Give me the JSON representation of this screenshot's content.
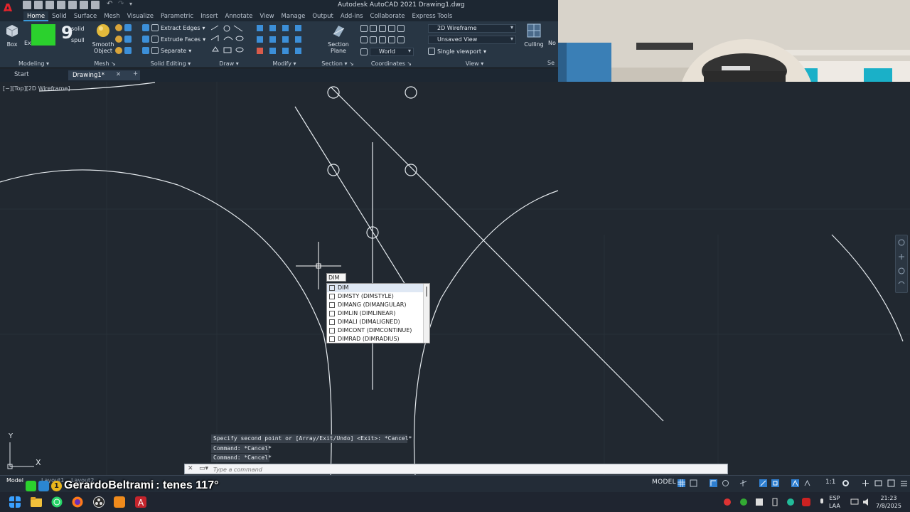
{
  "title_bar": {
    "app_logo": "A",
    "title": "Autodesk AutoCAD 2021    Drawing1.dwg"
  },
  "ribbon_tabs": [
    "Home",
    "Solid",
    "Surface",
    "Mesh",
    "Visualize",
    "Parametric",
    "Insert",
    "Annotate",
    "View",
    "Manage",
    "Output",
    "Add-ins",
    "Collaborate",
    "Express Tools"
  ],
  "active_tab": "Home",
  "ribbon": {
    "box_label": "Box",
    "extrude_label": "Extrude",
    "solid_label": "solid",
    "spull_label": "spull",
    "smooth_label_1": "Smooth",
    "smooth_label_2": "Object",
    "extract_edges": "Extract Edges",
    "extrude_faces": "Extrude Faces",
    "separate": "Separate",
    "section_plane_1": "Section",
    "section_plane_2": "Plane",
    "visual_style": "2D Wireframe",
    "named_view": "Unsaved View",
    "ucs": "World",
    "viewport": "Single viewport",
    "culling": "Culling",
    "no_label": "No",
    "panels": {
      "modeling": "Modeling",
      "mesh": "Mesh",
      "solid_editing": "Solid Editing",
      "draw": "Draw",
      "modify": "Modify",
      "section": "Section",
      "coordinates": "Coordinates",
      "view": "View",
      "se": "Se"
    }
  },
  "doc_tabs": {
    "start": "Start",
    "drawing": "Drawing1*",
    "close": "✕",
    "add": "+"
  },
  "viewport_label": "[−][Top][2D Wireframe]",
  "stream_overlay": {
    "counter": "9"
  },
  "autocomplete": {
    "typed": "DIM",
    "items": [
      "DIM",
      "DIMSTY (DIMSTYLE)",
      "DIMANG (DIMANGULAR)",
      "DIMLIN (DIMLINEAR)",
      "DIMALI (DIMALIGNED)",
      "DIMCONT (DIMCONTINUE)",
      "DIMRAD (DIMRADIUS)"
    ]
  },
  "command_history": [
    "Specify second point or [Array/Exit/Undo] <Exit>: *Cancel*",
    "Command: *Cancel*",
    "Command: *Cancel*"
  ],
  "command_line": {
    "placeholder": "Type a command",
    "close": "✕"
  },
  "ucs_icon": {
    "x": "X",
    "y": "Y"
  },
  "status_bar": {
    "model_tab": "Model",
    "layout1": "Layout1",
    "layout2": "Layout2",
    "model_label": "MODEL",
    "scale": "1:1"
  },
  "chat": {
    "username": "GerardoBeltrami",
    "message": ": tenes 117°",
    "badge": "1"
  },
  "taskbar": {
    "lang_1": "ESP",
    "lang_2": "LAA",
    "time": "21:23",
    "date": "7/8/2025"
  },
  "colors": {
    "canvas": "#212830",
    "ribbon": "#283644",
    "accent": "#3a9ad9",
    "logo_red": "#e4242c",
    "stream_green": "#2bd12d"
  }
}
